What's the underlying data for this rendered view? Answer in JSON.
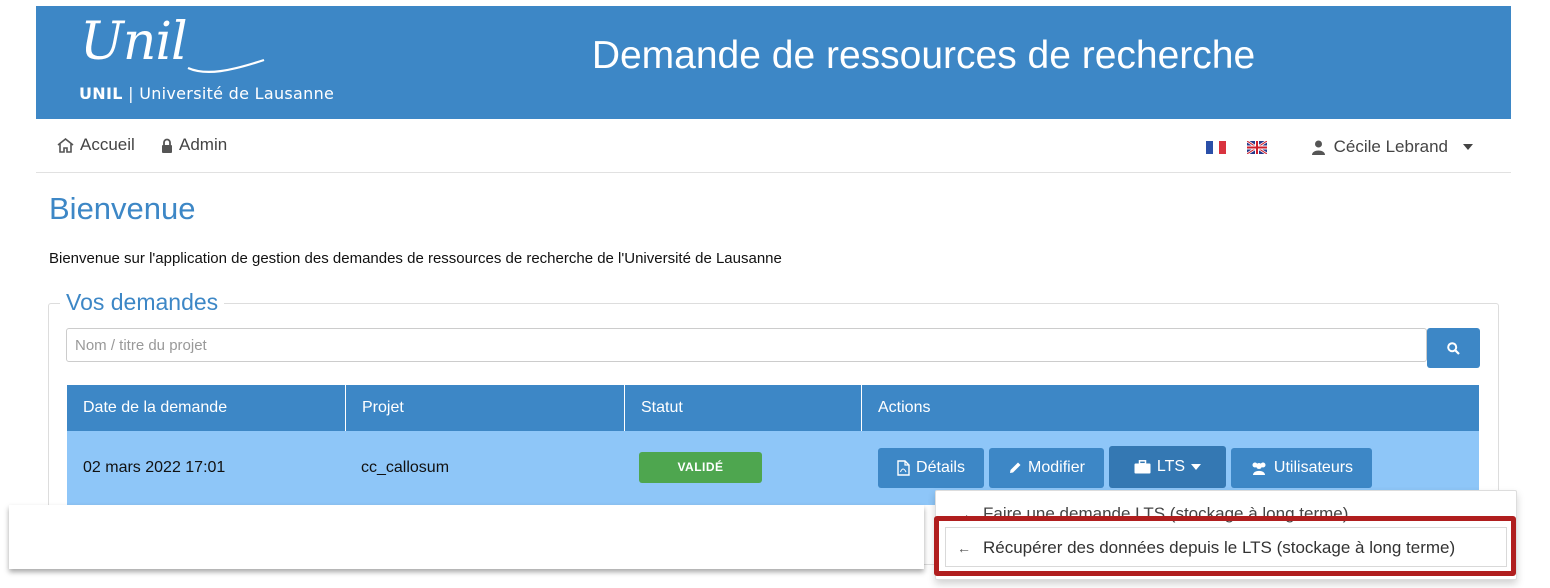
{
  "header": {
    "logo_script": "Unil",
    "logo_org_short": "UNIL",
    "logo_org_full": "Université de Lausanne",
    "title": "Demande de ressources de recherche"
  },
  "nav": {
    "home": "Accueil",
    "admin": "Admin",
    "user": "Cécile Lebrand"
  },
  "page": {
    "title": "Bienvenue",
    "intro": "Bienvenue sur l'application de gestion des demandes de ressources de recherche de l'Université de Lausanne"
  },
  "requests": {
    "legend": "Vos demandes",
    "search_placeholder": "Nom / titre du projet",
    "columns": [
      "Date de la demande",
      "Projet",
      "Statut",
      "Actions"
    ],
    "rows": [
      {
        "date": "02 mars 2022 17:01",
        "project": "cc_callosum",
        "status": "VALIDÉ"
      }
    ],
    "actions": {
      "details": "Détails",
      "edit": "Modifier",
      "lts": "LTS",
      "users": "Utilisateurs"
    }
  },
  "lts_menu": [
    "Faire une demande LTS (stockage à long terme)",
    "Récupérer des données depuis le LTS (stockage à long terme)"
  ],
  "colors": {
    "primary": "#3d87c6",
    "row_selected": "#8ec6f8",
    "success": "#4ea64f",
    "highlight": "#b01e1e"
  }
}
